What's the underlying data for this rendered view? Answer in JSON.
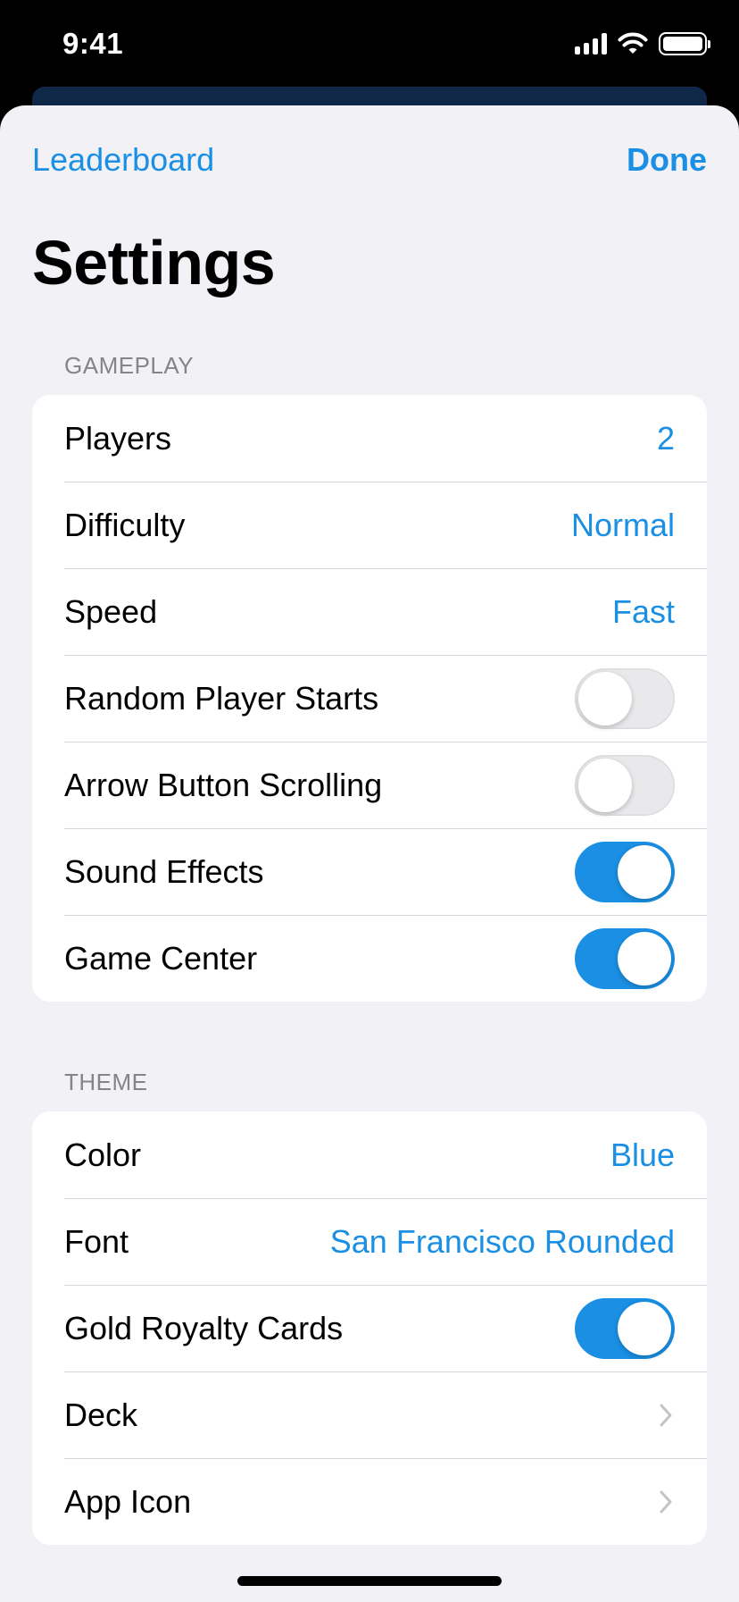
{
  "status_bar": {
    "time": "9:41"
  },
  "nav": {
    "left_label": "Leaderboard",
    "right_label": "Done"
  },
  "title": "Settings",
  "sections": {
    "gameplay": {
      "header": "GAMEPLAY",
      "rows": [
        {
          "label": "Players",
          "value": "2"
        },
        {
          "label": "Difficulty",
          "value": "Normal"
        },
        {
          "label": "Speed",
          "value": "Fast"
        },
        {
          "label": "Random Player Starts",
          "toggle": false
        },
        {
          "label": "Arrow Button Scrolling",
          "toggle": false
        },
        {
          "label": "Sound Effects",
          "toggle": true
        },
        {
          "label": "Game Center",
          "toggle": true
        }
      ]
    },
    "theme": {
      "header": "THEME",
      "rows": [
        {
          "label": "Color",
          "value": "Blue"
        },
        {
          "label": "Font",
          "value": "San Francisco Rounded"
        },
        {
          "label": "Gold Royalty Cards",
          "toggle": true
        },
        {
          "label": "Deck",
          "chevron": true
        },
        {
          "label": "App Icon",
          "chevron": true
        }
      ]
    }
  },
  "colors": {
    "accent": "#1a8fe3",
    "background": "#f1f1f6",
    "secondary_text": "#858589"
  }
}
